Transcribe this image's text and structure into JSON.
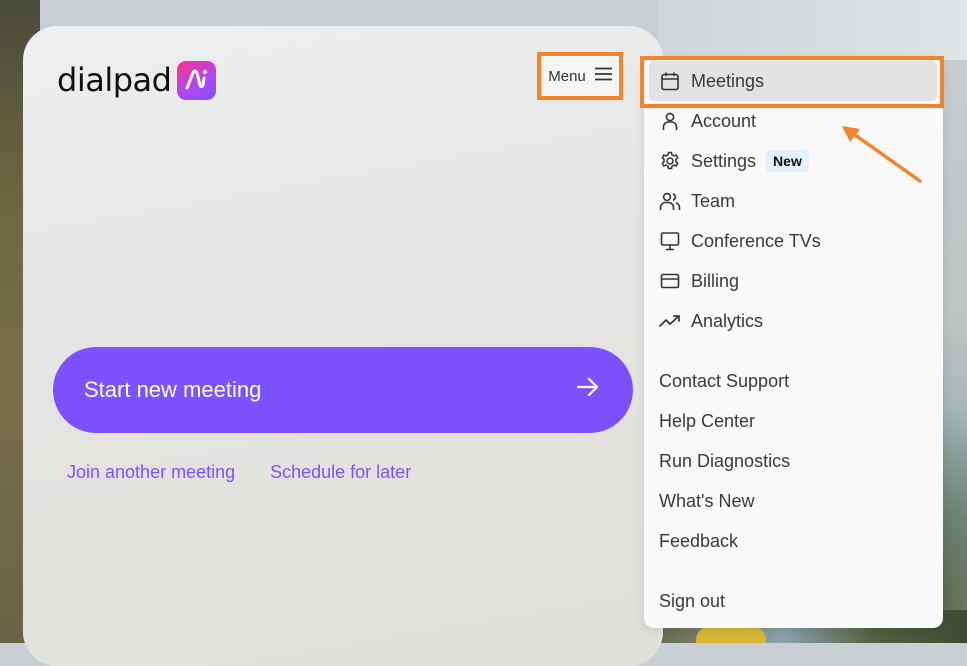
{
  "brand": {
    "name": "dialpad",
    "badge_text": "Ai"
  },
  "header": {
    "menu_label": "Menu"
  },
  "main": {
    "start_button_label": "Start new meeting",
    "links": [
      "Join another meeting",
      "Schedule for later"
    ]
  },
  "dropdown": {
    "icon_items": [
      {
        "label": "Meetings",
        "icon": "calendar-icon",
        "highlighted": true
      },
      {
        "label": "Account",
        "icon": "user-icon"
      },
      {
        "label": "Settings",
        "icon": "gear-icon",
        "badge": "New"
      },
      {
        "label": "Team",
        "icon": "users-icon"
      },
      {
        "label": "Conference TVs",
        "icon": "monitor-icon"
      },
      {
        "label": "Billing",
        "icon": "credit-card-icon"
      },
      {
        "label": "Analytics",
        "icon": "trending-up-icon"
      }
    ],
    "support_items": [
      "Contact Support",
      "Help Center",
      "Run Diagnostics",
      "What's New",
      "Feedback"
    ],
    "sign_out": "Sign out"
  },
  "colors": {
    "accent": "#7c52ff",
    "annotation": "#f5832a",
    "badge_bg": "#e6f0fb"
  }
}
